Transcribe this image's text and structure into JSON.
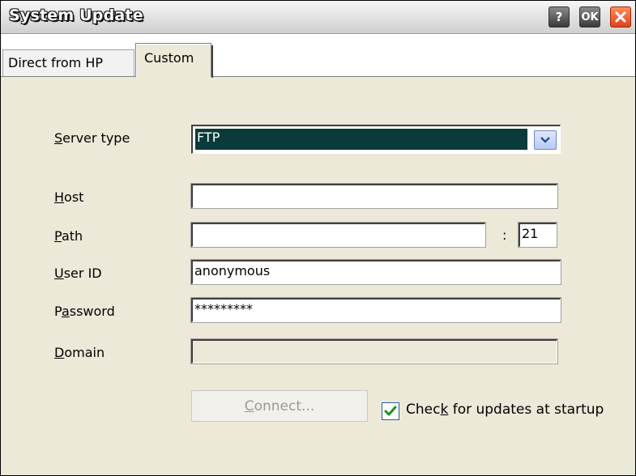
{
  "window": {
    "title": "System Update",
    "help_label": "?",
    "ok_label": "OK"
  },
  "tabs": [
    {
      "label": "Direct from HP",
      "selected": false
    },
    {
      "label": "Custom",
      "selected": true
    }
  ],
  "form": {
    "server_type": {
      "label_access": "S",
      "label_rest": "erver type",
      "value": "FTP"
    },
    "host": {
      "label_access": "H",
      "label_rest": "ost",
      "value": ""
    },
    "path": {
      "label_access": "P",
      "label_rest": "ath",
      "value": "",
      "port_separator": ":",
      "port": "21"
    },
    "user_id": {
      "label_access": "U",
      "label_rest": "ser ID",
      "value": "anonymous"
    },
    "password": {
      "label_pre": "P",
      "label_access": "a",
      "label_rest": "ssword",
      "value": "*********"
    },
    "domain": {
      "label_access": "D",
      "label_rest": "omain",
      "value": "",
      "disabled": true
    }
  },
  "connect_button": {
    "label_access": "C",
    "label_rest": "onnect...",
    "disabled": true
  },
  "startup_check": {
    "label_pre": "Chec",
    "label_access": "k",
    "label_rest": " for updates at startup",
    "checked": true
  },
  "colors": {
    "selection_bg": "#0a3a3a",
    "close_button": "#e0431c",
    "check_mark": "#1f8f2a"
  },
  "icons": {
    "help": "question-mark-icon",
    "close": "close-x-icon",
    "dropdown": "chevron-down-icon",
    "check": "checkmark-icon"
  }
}
